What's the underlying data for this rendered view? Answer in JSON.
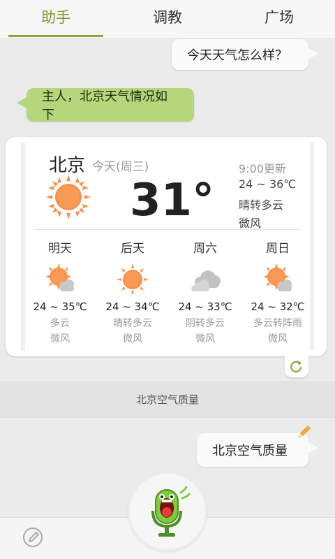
{
  "tabs": [
    {
      "label": "助手"
    },
    {
      "label": "调教"
    },
    {
      "label": "广场"
    }
  ],
  "chat": {
    "user_msg_1": "今天天气怎么样？",
    "bot_msg_1": "主人，北京天气情况如下",
    "user_msg_2": "北京空气质量"
  },
  "weather": {
    "city": "北京",
    "today_label": "今天(周三)",
    "temp": "31°",
    "update": "9:00更新",
    "range": "24 ~ 36℃",
    "condition": "晴转多云",
    "wind": "微风",
    "forecast": [
      {
        "day": "明天",
        "range": "24 ~ 35℃",
        "condition": "多云",
        "wind": "微风",
        "icon": "sun-cloud-icon"
      },
      {
        "day": "后天",
        "range": "24 ~ 34℃",
        "condition": "晴转多云",
        "wind": "微风",
        "icon": "sun-icon"
      },
      {
        "day": "周六",
        "range": "24 ~ 33℃",
        "condition": "阴转多云",
        "wind": "微风",
        "icon": "cloud-icon"
      },
      {
        "day": "周日",
        "range": "24 ~ 32℃",
        "condition": "多云转阵雨",
        "wind": "微风",
        "icon": "sun-cloud-icon"
      }
    ]
  },
  "banner": {
    "text": "北京空气质量"
  },
  "colors": {
    "accent": "#8aa83a",
    "bot_bubble": "#b5d67a",
    "sun": "#f7914a"
  }
}
